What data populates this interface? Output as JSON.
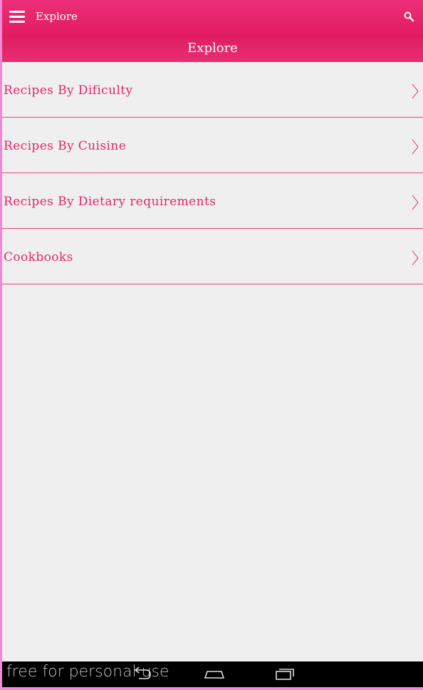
{
  "topbar": {
    "title": "Explore",
    "menu_icon": "hamburger-menu-icon",
    "search_icon": "search-icon"
  },
  "subheader": {
    "title": "Explore"
  },
  "list": {
    "items": [
      {
        "label": "Recipes By Dificulty"
      },
      {
        "label": "Recipes By Cuisine"
      },
      {
        "label": "Recipes By Dietary requirements"
      },
      {
        "label": "Cookbooks"
      }
    ]
  },
  "navbar": {
    "watermark": "free for personal use",
    "buttons": [
      "back-icon",
      "home-icon",
      "recents-icon"
    ]
  },
  "colors": {
    "accent": "#e3266b",
    "bar": "#ec2f78",
    "background": "#efefef",
    "frame": "#f08bd2"
  }
}
